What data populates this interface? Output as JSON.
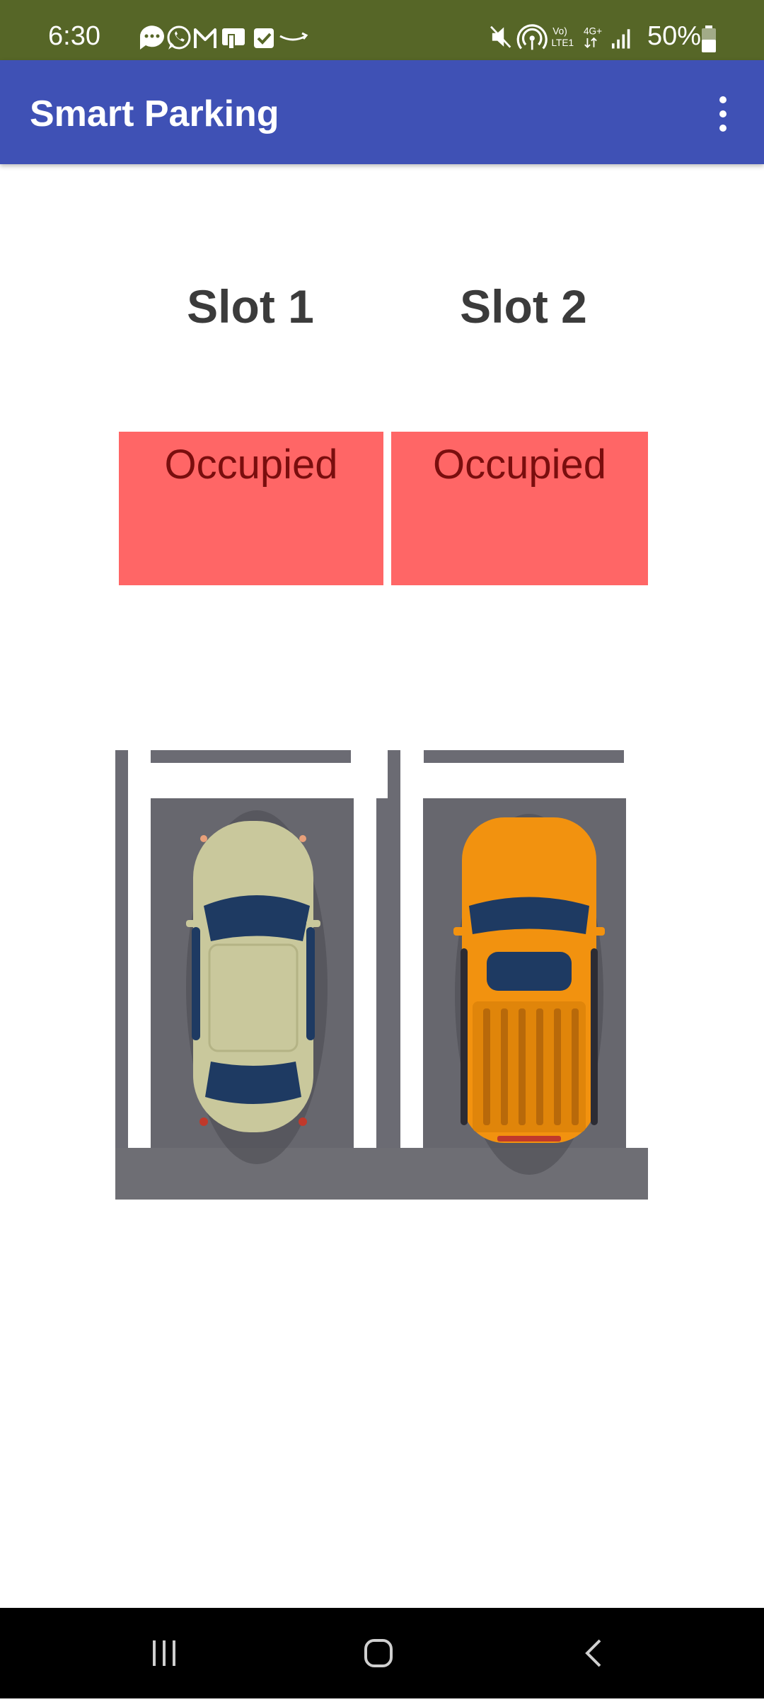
{
  "status_bar": {
    "time": "6:30",
    "battery": "50%",
    "left_icons": [
      "chat-bubble-icon",
      "whatsapp-icon",
      "gmail-icon",
      "phone-ui-icon",
      "checklist-icon",
      "amazon-icon"
    ],
    "right_icons": [
      "mute-icon",
      "hotspot-icon",
      "volte-icon",
      "4g-plus-icon",
      "signal-icon",
      "battery-icon"
    ],
    "volte_label": "Vo) LTE1",
    "network_label": "4G+"
  },
  "app_bar": {
    "title": "Smart Parking",
    "color": "#3f51b5"
  },
  "slots": [
    {
      "title": "Slot 1",
      "status": "Occupied",
      "status_color": "#ff6666"
    },
    {
      "title": "Slot 2",
      "status": "Occupied",
      "status_color": "#ff6666"
    }
  ],
  "parking_image": {
    "cars": [
      {
        "slot": "Slot 1",
        "color": "#c9c89c"
      },
      {
        "slot": "Slot 2",
        "color": "#f2920f"
      }
    ]
  },
  "nav_bar": {
    "buttons": [
      "recent-apps-icon",
      "home-icon",
      "back-icon"
    ]
  }
}
